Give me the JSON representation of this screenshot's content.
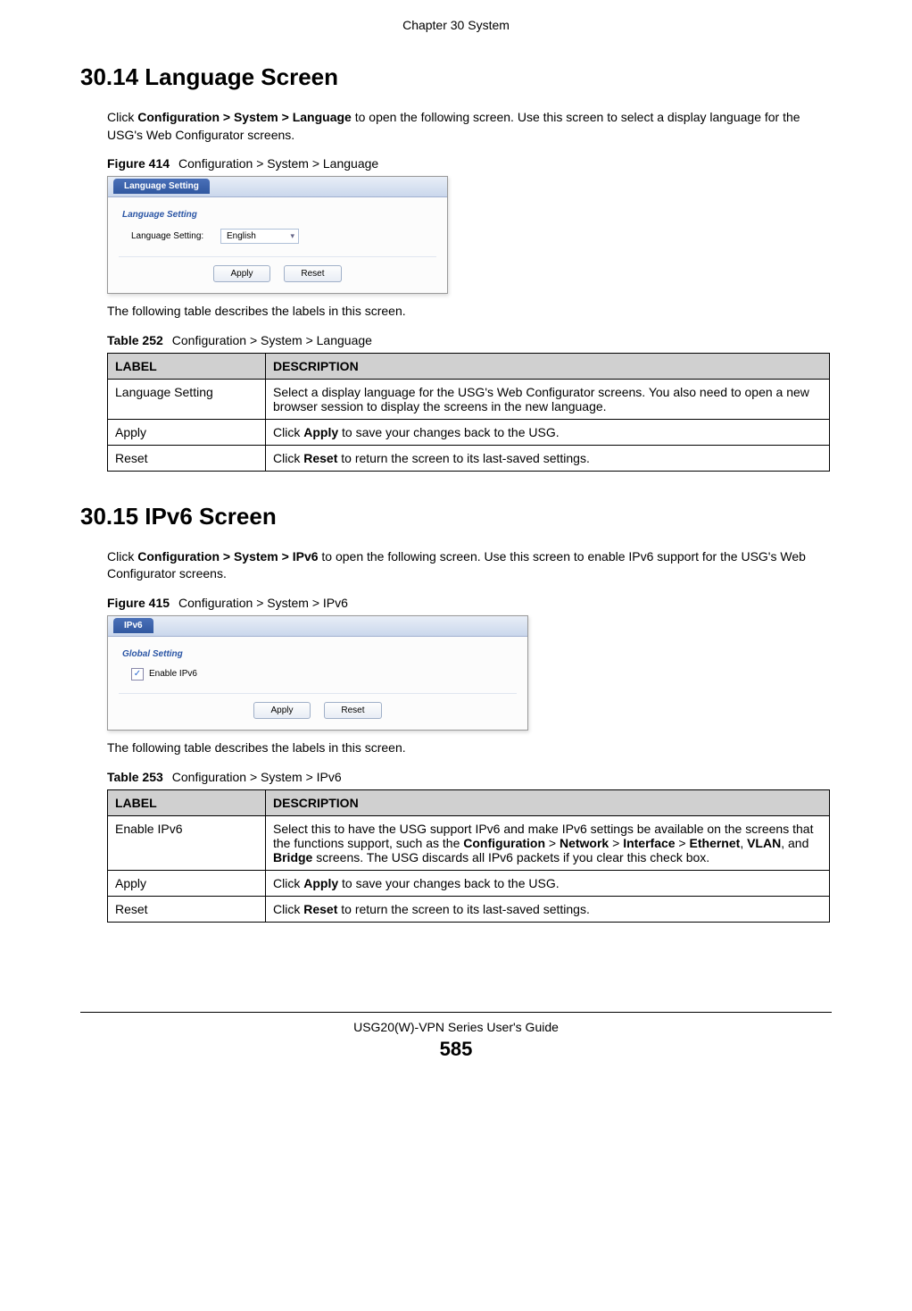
{
  "chapter_header": "Chapter 30 System",
  "section_3014": {
    "heading": "30.14  Language Screen",
    "intro_pre": "Click ",
    "intro_bold": "Configuration > System > Language",
    "intro_post": " to open the following screen. Use this screen to select a display language for the USG's Web Configurator screens.",
    "figure_label": "Figure 414",
    "figure_caption": "Configuration > System > Language",
    "screenshot": {
      "tab": "Language Setting",
      "section_title": "Language Setting",
      "field_label": "Language Setting:",
      "field_value": "English",
      "btn_apply": "Apply",
      "btn_reset": "Reset"
    },
    "post_figure_text": "The following table describes the labels in this screen.",
    "table_label": "Table 252",
    "table_caption": "Configuration > System > Language",
    "table": {
      "header_label": "LABEL",
      "header_desc": "DESCRIPTION",
      "rows": [
        {
          "label": "Language Setting",
          "desc": "Select a display language for the USG's Web Configurator screens. You also need to open a new browser session to display the screens in the new language."
        },
        {
          "label": "Apply",
          "desc_pre": "Click ",
          "desc_bold": "Apply",
          "desc_post": " to save your changes back to the USG."
        },
        {
          "label": "Reset",
          "desc_pre": "Click ",
          "desc_bold": "Reset",
          "desc_post": " to return the screen to its last-saved settings."
        }
      ]
    }
  },
  "section_3015": {
    "heading": "30.15  IPv6 Screen",
    "intro_pre": "Click ",
    "intro_bold": "Configuration > System > IPv6",
    "intro_post": " to open the following screen. Use this screen to enable IPv6 support for the USG's Web Configurator screens.",
    "figure_label": "Figure 415",
    "figure_caption": "Configuration > System > IPv6",
    "screenshot": {
      "tab": "IPv6",
      "section_title": "Global Setting",
      "checkbox_label": "Enable IPv6",
      "btn_apply": "Apply",
      "btn_reset": "Reset"
    },
    "post_figure_text": "The following table describes the labels in this screen.",
    "table_label": "Table 253",
    "table_caption": "Configuration > System > IPv6",
    "table": {
      "header_label": "LABEL",
      "header_desc": "DESCRIPTION",
      "rows": [
        {
          "label": "Enable IPv6",
          "desc_pre": "Select this to have the USG support IPv6 and make IPv6 settings be available on the screens that the functions support, such as the ",
          "desc_b1": "Configuration",
          "desc_m1": " > ",
          "desc_b2": "Network",
          "desc_m2": " > ",
          "desc_b3": "Interface",
          "desc_m3": " > ",
          "desc_b4": "Ethernet",
          "desc_m4": ", ",
          "desc_b5": "VLAN",
          "desc_m5": ", and ",
          "desc_b6": "Bridge",
          "desc_post": " screens. The USG discards all IPv6 packets if you clear this check box."
        },
        {
          "label": "Apply",
          "desc_pre": "Click ",
          "desc_bold": "Apply",
          "desc_post": " to save your changes back to the USG."
        },
        {
          "label": "Reset",
          "desc_pre": "Click ",
          "desc_bold": "Reset",
          "desc_post": " to return the screen to its last-saved settings."
        }
      ]
    }
  },
  "footer": {
    "guide": "USG20(W)-VPN Series User's Guide",
    "page": "585"
  }
}
